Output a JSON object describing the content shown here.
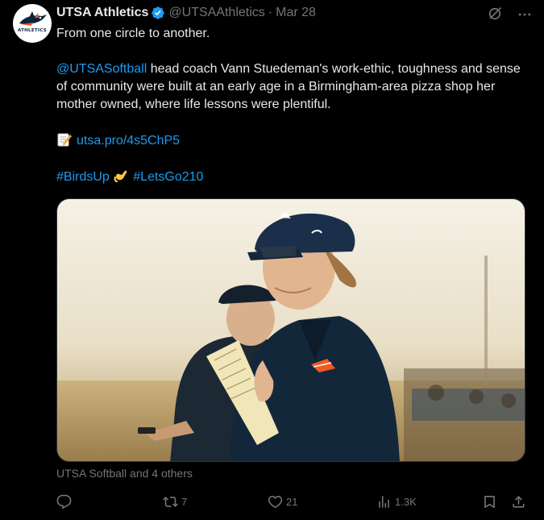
{
  "tweet": {
    "author_name": "UTSA Athletics",
    "handle": "@UTSAAthletics",
    "separator": "·",
    "date": "Mar 28",
    "avatar_text": "ATHLETICS",
    "text_line1": "From one circle to another.",
    "mention": "@UTSASoftball",
    "text_body": " head coach Vann Stuedeman's work-ethic, toughness and sense of community were built at an early age in a Birmingham-area pizza shop her mother owned, where life lessons were plentiful.",
    "link": "utsa.pro/4s5ChP5",
    "hashtag1": "#BirdsUp",
    "hashtag2": "#LetsGo210",
    "tagged": "UTSA Softball and 4 others",
    "icons": {
      "verified": "verified-badge-icon",
      "grok": "grok-icon",
      "more": "more-icon",
      "memo": "memo-emoji-icon",
      "hand": "call-me-hand-emoji-icon"
    }
  },
  "actions": {
    "replies": "",
    "retweets": "7",
    "likes": "21",
    "views": "1.3K"
  },
  "colors": {
    "background": "#000000",
    "text": "#e7e9ea",
    "muted": "#71767b",
    "link": "#1d9bf0"
  }
}
